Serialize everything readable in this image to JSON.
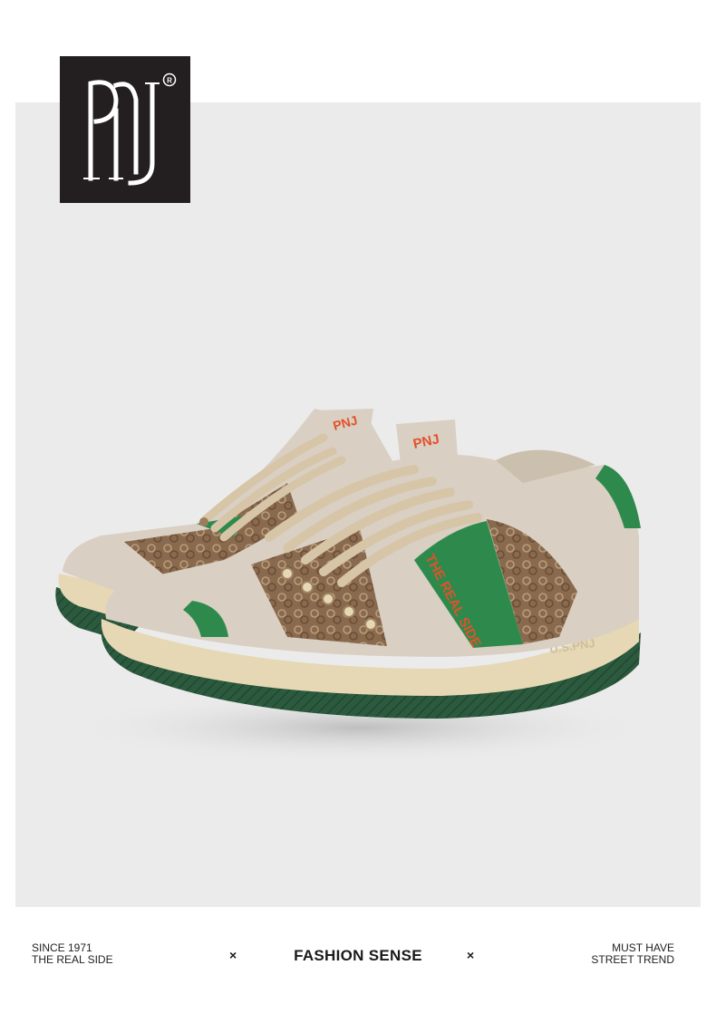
{
  "brand": {
    "logo_text": "PNJ",
    "registered_mark": "®"
  },
  "product": {
    "stripe_text": "THE REAL SIDE",
    "tongue_label": "PNJ",
    "sole_text": "U.S.PNJ",
    "colors": {
      "leather": "#d9cfc2",
      "canvas": "#8a6a4e",
      "stripe": "#2e8a4c",
      "accent_text": "#e2512a",
      "sole": "#e6d8b5",
      "outsole": "#2b5a3e"
    }
  },
  "footer": {
    "left_line1": "SINCE 1971",
    "left_line2": "THE REAL SIDE",
    "separator": "×",
    "center": "FASHION SENSE",
    "right_line1": "MUST HAVE",
    "right_line2": "STREET TREND"
  }
}
